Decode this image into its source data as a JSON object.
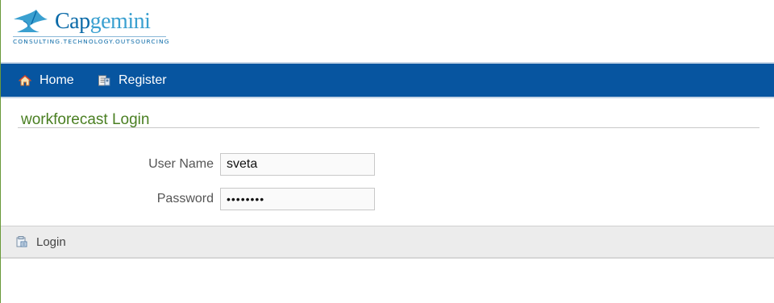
{
  "brand": {
    "logo_word_part1": "Cap",
    "logo_word_part2": "gemini",
    "tagline": "CONSULTING.TECHNOLOGY.OUTSOURCING"
  },
  "nav": {
    "items": [
      {
        "label": "Home",
        "icon": "home-icon"
      },
      {
        "label": "Register",
        "icon": "register-icon"
      }
    ]
  },
  "page": {
    "title": "workforecast Login"
  },
  "form": {
    "username_label": "User Name",
    "username_value": "sveta",
    "password_label": "Password",
    "password_value": "••••••••"
  },
  "actions": {
    "login_label": "Login",
    "login_icon": "login-icon"
  },
  "colors": {
    "nav_background": "#0755a0",
    "title_green": "#4a7f22",
    "brand_blue": "#0a6aa8"
  }
}
